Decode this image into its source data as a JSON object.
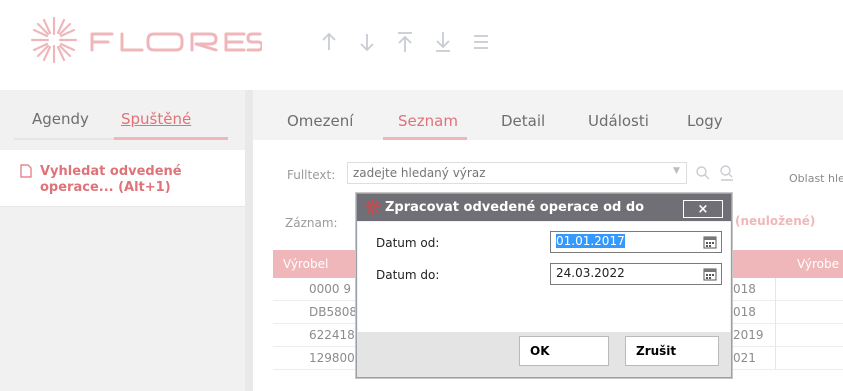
{
  "app": {
    "logo_text": "FLORES",
    "brand_color": "#f0b7bb",
    "accent_text_color": "#e0737a"
  },
  "toolbar": {
    "icons": [
      "arrow-up-icon",
      "arrow-down-icon",
      "move-to-top-icon",
      "move-to-bottom-icon",
      "menu-icon"
    ]
  },
  "left_panel": {
    "tabs": [
      {
        "label": "Agendy",
        "active": false
      },
      {
        "label": "Spuštěné",
        "active": true
      }
    ],
    "items": [
      {
        "label": "Vyhledat odvedené operace... (Alt+1)",
        "icon": "document-icon"
      }
    ]
  },
  "main": {
    "tabs": [
      {
        "label": "Omezení",
        "active": false
      },
      {
        "label": "Seznam",
        "active": true
      },
      {
        "label": "Detail",
        "active": false
      },
      {
        "label": "Události",
        "active": false
      },
      {
        "label": "Logy",
        "active": false
      }
    ],
    "fulltext": {
      "label": "Fulltext:",
      "placeholder": "zadejte hledaný výraz"
    },
    "oblast_label": "Oblast hled",
    "zaznam_label": "Záznam:",
    "neulozene_label": "(neuložené)",
    "table": {
      "headers": [
        "Výrobel",
        "Výrobe"
      ],
      "rows": [
        {
          "c1": "0000 9",
          "c2": "018"
        },
        {
          "c1": "DB5808",
          "c2": "018"
        },
        {
          "c1": "622418",
          "c2": "2019"
        },
        {
          "c1": "129800",
          "c2": "021"
        }
      ]
    }
  },
  "dialog": {
    "title": "Zpracovat odvedené operace od do",
    "close_label": "×",
    "fields": [
      {
        "label": "Datum od:",
        "value": "01.01.2017",
        "selected": true
      },
      {
        "label": "Datum do:",
        "value": "24.03.2022",
        "selected": false
      }
    ],
    "ok_label": "OK",
    "cancel_label": "Zrušit"
  }
}
